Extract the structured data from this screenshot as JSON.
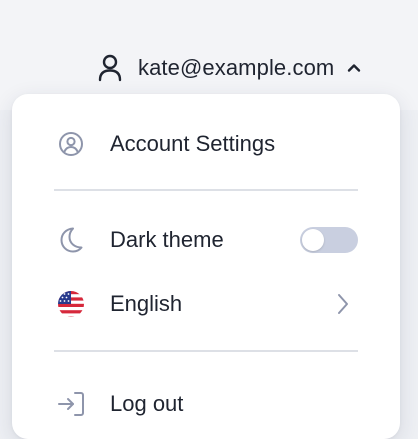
{
  "header": {
    "email": "kate@example.com",
    "user_icon": "user-icon",
    "caret_icon": "chevron-up-icon"
  },
  "menu": {
    "account_settings": {
      "label": "Account Settings",
      "icon": "user-circle-icon"
    },
    "dark_theme": {
      "label": "Dark theme",
      "icon": "moon-icon",
      "enabled": false
    },
    "language": {
      "label": "English",
      "icon": "us-flag-icon",
      "trail_icon": "chevron-right-icon"
    },
    "logout": {
      "label": "Log out",
      "icon": "logout-icon"
    }
  },
  "colors": {
    "text": "#1f2430",
    "icon_muted": "#8e95ab",
    "toggle_off": "#c9cfe0",
    "divider": "#dde0e6"
  }
}
